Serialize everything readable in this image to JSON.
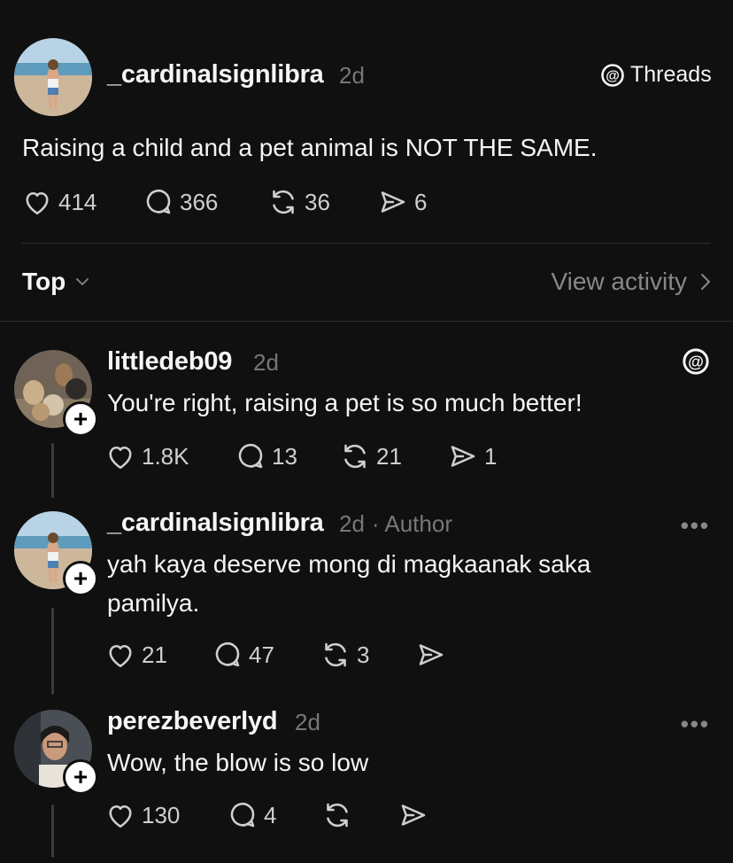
{
  "header": {
    "brand_label": "Threads"
  },
  "post": {
    "author": "_cardinalsignlibra",
    "time": "2d",
    "text": "Raising a child and a pet animal is NOT THE SAME.",
    "likes": "414",
    "replies": "366",
    "reposts": "36",
    "shares": "6"
  },
  "filter": {
    "sort_label": "Top",
    "activity_label": "View activity"
  },
  "replies": [
    {
      "author": "littledeb09",
      "time": "2d",
      "text": "You're right, raising a pet is so much better!",
      "likes": "1.8K",
      "replies": "13",
      "reposts": "21",
      "shares": "1"
    },
    {
      "author": "_cardinalsignlibra",
      "time": "2d",
      "author_tag": "· Author",
      "text_line1": "yah kaya deserve mong di magkaanak saka",
      "text_line2": "pamilya.",
      "likes": "21",
      "replies": "47",
      "reposts": "3",
      "more_label": "•••"
    },
    {
      "author": "perezbeverlyd",
      "time": "2d",
      "text": "Wow, the blow is so low",
      "likes": "130",
      "replies": "4",
      "more_label": "•••"
    }
  ]
}
